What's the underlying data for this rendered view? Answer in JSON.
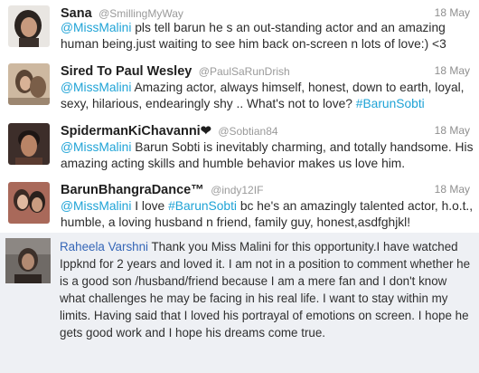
{
  "tweets": [
    {
      "name": "Sana",
      "handle": "@SmillingMyWay",
      "date": "18 May",
      "mention": "@MissMalini",
      "text": " pls tell barun he s an out-standing actor and an amazing human being.just waiting to see him back on-screen n lots of love:) <3"
    },
    {
      "name": "Sired To Paul Wesley",
      "handle": "@PaulSaRunDrish",
      "date": "18 May",
      "mention": "@MissMalini",
      "text": " Amazing actor, always himself, honest, down to earth, loyal, sexy, hilarious, endearingly shy .. What's not to love? ",
      "hashtag": "#BarunSobti"
    },
    {
      "name": "SpidermanKiChavanni❤",
      "handle": "@Sobtian84",
      "date": "18 May",
      "mention": "@MissMalini",
      "text": " Barun Sobti is inevitably charming, and totally handsome. His amazing acting skills and humble behavior makes us love him."
    },
    {
      "name": "BarunBhangraDance™",
      "handle": "@indy12IF",
      "date": "18 May",
      "mention": "@MissMalini",
      "text_before_hashtag": " I love ",
      "hashtag": "#BarunSobti",
      "text_after_hashtag": " bc he's an amazingly talented actor, h.o.t., humble, a loving husband n friend, family guy, honest,asdfghjkl!"
    }
  ],
  "comment": {
    "author": "Raheela Varshni",
    "text": " Thank you Miss Malini for this opportunity.I have watched Ippknd for 2 years and loved it. I am not in a position to comment whether he is a good son /husband/friend because I am a mere fan and I don't know what challenges he may be facing in his real life. I want to stay within my limits. Having said that I loved his portrayal of emotions on screen. I hope he gets good work and I hope his dreams come true."
  }
}
